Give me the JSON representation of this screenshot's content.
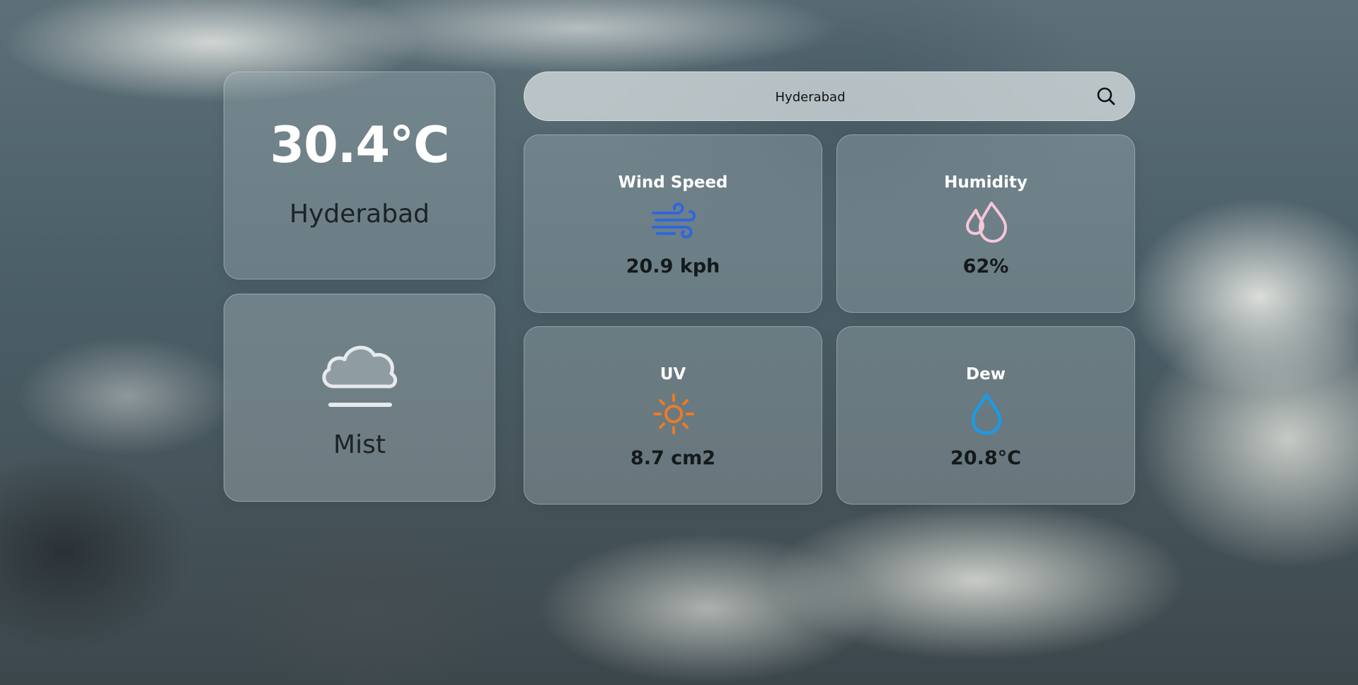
{
  "search": {
    "value": "Hyderabad",
    "icon": "search-icon"
  },
  "current": {
    "temperature": "30.4°C",
    "city": "Hyderabad"
  },
  "condition": {
    "label": "Mist",
    "icon": "mist-cloud-icon"
  },
  "stats": {
    "wind": {
      "title": "Wind Speed",
      "value": "20.9 kph",
      "icon": "wind-icon",
      "color": "#2f66e0"
    },
    "humidity": {
      "title": "Humidity",
      "value": "62%",
      "icon": "humidity-drops-icon",
      "color": "#f7c6d8"
    },
    "uv": {
      "title": "UV",
      "value": "8.7 cm2",
      "icon": "sun-icon",
      "color": "#f07a22"
    },
    "dew": {
      "title": "Dew",
      "value": "20.8°C",
      "icon": "water-drop-icon",
      "color": "#1b9be6"
    }
  }
}
